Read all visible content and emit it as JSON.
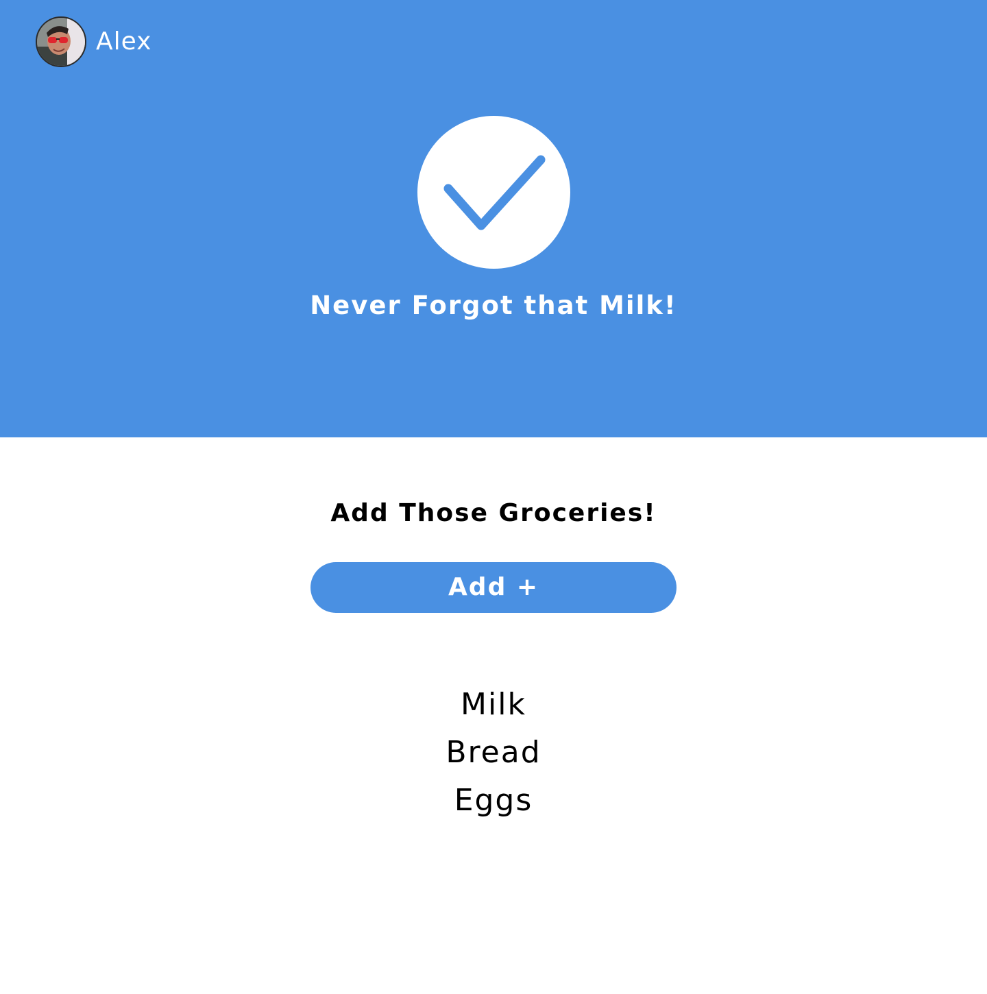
{
  "header": {
    "user_name": "Alex",
    "avatar_icon": "user-avatar-photo"
  },
  "hero": {
    "icon": "checkmark-icon",
    "tagline": "Never Forgot that Milk!",
    "background_color": "#4a90e2"
  },
  "main": {
    "title": "Add Those Groceries!",
    "add_button_label": "Add +",
    "groceries": [
      {
        "name": "Milk"
      },
      {
        "name": "Bread"
      },
      {
        "name": "Eggs"
      }
    ]
  },
  "colors": {
    "accent": "#4a90e2",
    "text": "#000000",
    "background": "#ffffff"
  }
}
